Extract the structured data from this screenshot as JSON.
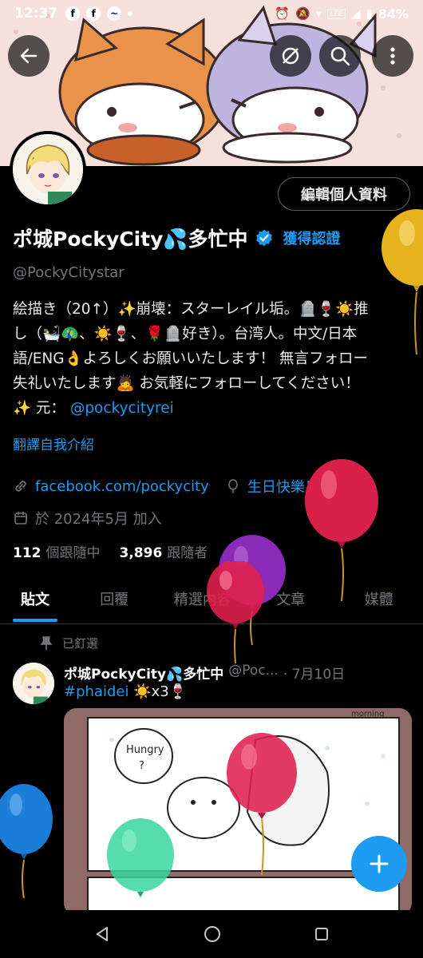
{
  "status_bar": {
    "time": "12:37",
    "battery": "84%",
    "network": "LTE"
  },
  "header": {
    "back_icon": "arrow-left-icon",
    "sync_icon": "sync-slash-icon",
    "search_icon": "search-icon",
    "more_icon": "more-vertical-icon"
  },
  "profile": {
    "edit_label": "編輯個人資料",
    "name": "ポ城PockyCity💦多忙中",
    "verify_label": "獲得認證",
    "handle": "@PockyCitystar",
    "bio_lines": [
      "絵描き（20↑）✨崩壊：スターレイル垢。🪦🍷☀️推",
      "し（🛀🦚、☀️🍷、🌹🪦好き）。台湾人。中文/日本",
      "語/ENG👌よろしくお願いいたします！ 無言フォロー",
      "失礼いたします🙇 お気軽にフォローしてください！"
    ],
    "bio_last_prefix": "✨ 元：",
    "bio_link": "@pockycityrei",
    "translate_label": "翻譯自我介紹",
    "website": "facebook.com/pockycity",
    "birthday": "生日快樂！",
    "joined": "於 2024年5月 加入",
    "following_count": "112",
    "following_label": "個跟隨中",
    "followers_count": "3,896",
    "followers_label": "跟隨者"
  },
  "tabs": [
    {
      "label": "貼文",
      "active": true
    },
    {
      "label": "回覆",
      "active": false
    },
    {
      "label": "精選內容",
      "active": false
    },
    {
      "label": "文章",
      "active": false
    },
    {
      "label": "媒體",
      "active": false
    }
  ],
  "pinned_post": {
    "pinned_label": "已釘選",
    "author": "ポ城PockyCity💦多忙中",
    "handle_trunc": "@Poc...",
    "date": "· 7月10日",
    "hashtag": "#phaidei",
    "text_suffix": " ☀️x3🍷",
    "image_text_hungry": "Hungry",
    "image_text_q": "?",
    "image_text_morning": "morning"
  },
  "fab_icon": "plus-icon",
  "nav": {
    "back_icon": "triangle-back-icon",
    "home_icon": "circle-home-icon",
    "recents_icon": "square-recents-icon"
  },
  "colors": {
    "accent": "#1d9bf0",
    "background": "#000000",
    "muted": "#71767b"
  }
}
